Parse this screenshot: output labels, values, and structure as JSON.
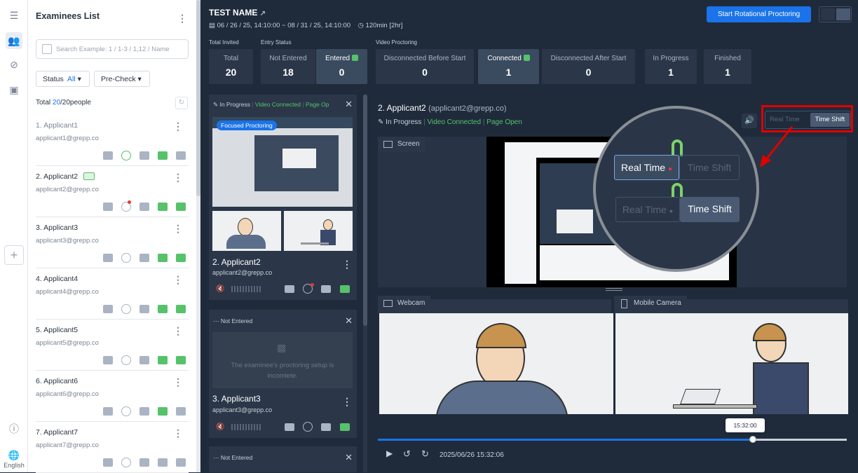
{
  "rail": {
    "language": "English"
  },
  "panel": {
    "title": "Examinees List",
    "search_placeholder": "Search Example: 1 / 1-3 / 1,12 / Name",
    "filter_status_label": "Status",
    "filter_status_value": "All",
    "filter_precheck_label": "Pre-Check",
    "total_label": "Total",
    "total_filtered": "20",
    "total_all": "/20people",
    "examinees": [
      {
        "name": "1. Applicant1",
        "email": "applicant1@grepp.co"
      },
      {
        "name": "2. Applicant2",
        "email": "applicant2@grepp.co"
      },
      {
        "name": "3. Applicant3",
        "email": "applicant3@grepp.co"
      },
      {
        "name": "4. Applicant4",
        "email": "applicant4@grepp.co"
      },
      {
        "name": "5. Applicant5",
        "email": "applicant5@grepp.co"
      },
      {
        "name": "6. Applicant6",
        "email": "applicant6@grepp.co"
      },
      {
        "name": "7. Applicant7",
        "email": "applicant7@grepp.co"
      }
    ]
  },
  "header": {
    "test_name": "TEST NAME",
    "schedule": "06 / 26 / 25, 14:10:00 ~ 08 / 31 / 25, 14:10:00",
    "duration": "120min [2hr]",
    "start_button": "Start Rotational Proctoring"
  },
  "groups": {
    "total_invited": "Total Invited",
    "entry_status": "Entry Status",
    "video_proctoring": "Video Proctoring"
  },
  "stats": [
    {
      "label": "Total",
      "value": "20"
    },
    {
      "label": "Not Entered",
      "value": "18"
    },
    {
      "label": "Entered",
      "value": "0"
    },
    {
      "label": "Disconnected Before Start",
      "value": "0"
    },
    {
      "label": "Connected",
      "value": "1"
    },
    {
      "label": "Disconnected After Start",
      "value": "0"
    },
    {
      "label": "In Progress",
      "value": "1"
    },
    {
      "label": "Finished",
      "value": "1"
    }
  ],
  "cards": [
    {
      "status": "In Progress",
      "video": "Video Connected",
      "page": "Page Op",
      "badge": "Focused Proctoring",
      "name": "2. Applicant2",
      "email": "applicant2@grepp.co"
    },
    {
      "status": "Not Entered",
      "message": "The examinee's proctoring setup is incomlete.",
      "name": "3. Applicant3",
      "email": "applicant3@grepp.co"
    },
    {
      "status": "Not Entered"
    }
  ],
  "main": {
    "name": "2. Applicant2",
    "email": "(applicant2@grepp.co)",
    "status": "In Progress",
    "video": "Video Connected",
    "page": "Page Open",
    "toggle_real": "Real Time",
    "toggle_shift": "Time Shift",
    "screen_label": "Screen",
    "webcam_label": "Webcam",
    "mobile_label": "Mobile Camera",
    "tooltip_time": "15:32:00",
    "playback_time": "2025/06/26 15:32:06",
    "progress": 0.8
  },
  "colors": {
    "accent": "#1a73e8",
    "green": "#56c26a",
    "highlight": "#e00000"
  }
}
